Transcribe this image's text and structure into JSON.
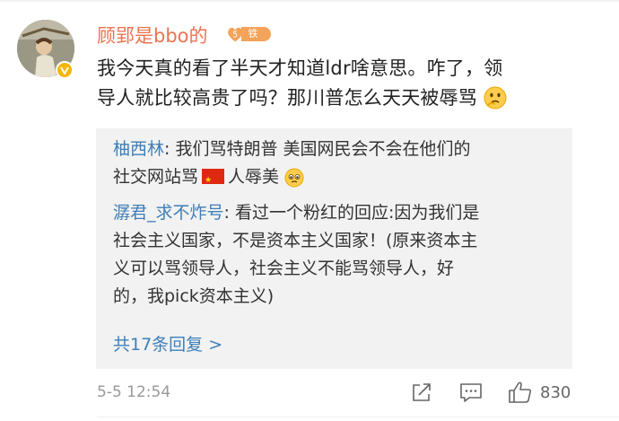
{
  "comment": {
    "username": "顾郢是bbo的",
    "fan_badge": "铁粉",
    "fan_badge_level": "5",
    "text_line1": "我今天真的看了半天才知道ldr啥意思。咋了，领",
    "text_line2": "导人就比较高贵了吗？那川普怎么天天被辱骂",
    "timestamp": "5-5 12:54",
    "like_count": "830"
  },
  "replies": [
    {
      "name": "柚西林",
      "line1": ": 我们骂特朗普 美国网民会不会在他们的",
      "line2_prefix": "社交网站骂",
      "line2_suffix": "人辱美"
    },
    {
      "name": "潺君_求不炸号",
      "line1": ": 看过一个粉红的回应:因为我们是",
      "line2": "社会主义国家，不是资本主义国家！(原来资本主",
      "line3": "义可以骂领导人，社会主义不能骂领导人，好",
      "line4": "的，我pick资本主义)"
    }
  ],
  "more_replies": "共17条回复 >",
  "icons": [
    "avatar",
    "verified-badge-icon",
    "fan-badge-icon",
    "thinking-emoji-icon",
    "china-flag-icon",
    "pleading-emoji-icon",
    "share-icon",
    "comment-icon",
    "like-icon"
  ]
}
